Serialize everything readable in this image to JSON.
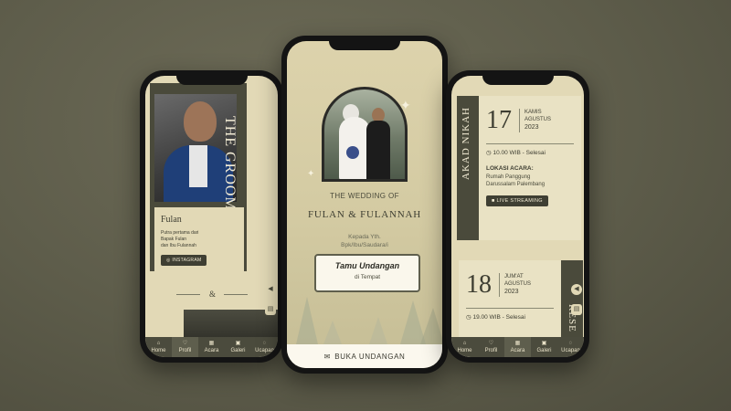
{
  "left_screen": {
    "groom_title": "THE GROOM",
    "groom_name": "Fulan",
    "groom_desc": [
      "Putra pertama dari",
      "Bapak Fulan",
      "dan Ibu Fulannah"
    ],
    "instagram_label": "INSTAGRAM",
    "instagram_icon": "instagram-icon",
    "ampersand": "&"
  },
  "center_screen": {
    "wedding_of": "THE WEDDING OF",
    "couple_names": "FULAN & FULANNAH",
    "kepada_line1": "Kepada Yth.",
    "kepada_line2": "Bpk/Ibu/Saudara/i",
    "guest_name": "Tamu Undangan",
    "guest_place": "di Tempat",
    "open_button": "BUKA UNDANGAN",
    "open_icon": "envelope-icon"
  },
  "right_screen": {
    "akad_title": "AKAD NIKAH",
    "akad_date": "17",
    "akad_day": "KAMIS",
    "akad_month": "AGUSTUS",
    "akad_year": "2023",
    "akad_time": "10.00 WIB - Selesai",
    "location_title": "LOKASI ACARA:",
    "location_line1": "Rumah Panggung",
    "location_line2": "Darussalam Palembang",
    "live_label": "LIVE STREAMING",
    "resepsi_title": "RESE",
    "resepsi_date": "18",
    "resepsi_day": "JUM'AT",
    "resepsi_month": "AGUSTUS",
    "resepsi_year": "2023",
    "resepsi_time": "19.00 WIB - Selesai"
  },
  "nav": {
    "items": [
      {
        "label": "Home",
        "icon": "home-icon"
      },
      {
        "label": "Profil",
        "icon": "heart-icon"
      },
      {
        "label": "Acara",
        "icon": "calendar-icon"
      },
      {
        "label": "Galeri",
        "icon": "image-icon"
      },
      {
        "label": "Ucapan",
        "icon": "chat-icon"
      }
    ]
  },
  "colors": {
    "accent_dark": "#4a4a3b",
    "cream": "#e2d9b6",
    "background": "#5d5c4a"
  }
}
